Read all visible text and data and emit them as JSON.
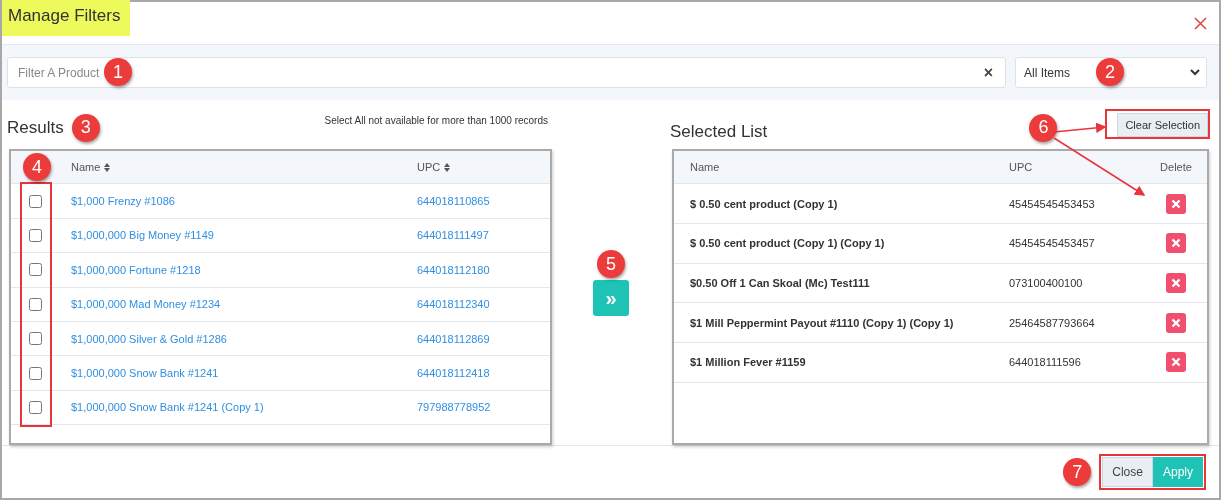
{
  "window": {
    "title": "Manage Filters",
    "title_highlighted": true
  },
  "filter": {
    "placeholder": "Filter A Product",
    "clear_icon": "×",
    "callout": "1"
  },
  "category_select": {
    "value": "All Items",
    "callout": "2"
  },
  "results": {
    "title": "Results",
    "callout": "3",
    "note": "Select All not available for more than 1000 records",
    "checkbox_callout": "4",
    "columns": [
      "Name",
      "UPC"
    ],
    "rows": [
      {
        "name": "$1,000 Frenzy #1086",
        "upc": "644018110865",
        "checked": false
      },
      {
        "name": "$1,000,000 Big Money #1149",
        "upc": "644018111497",
        "checked": false
      },
      {
        "name": "$1,000,000 Fortune #1218",
        "upc": "644018112180",
        "checked": false
      },
      {
        "name": "$1,000,000 Mad Money #1234",
        "upc": "644018112340",
        "checked": false
      },
      {
        "name": "$1,000,000 Silver & Gold #1286",
        "upc": "644018112869",
        "checked": false
      },
      {
        "name": "$1,000,000 Snow Bank #1241",
        "upc": "644018112418",
        "checked": false
      },
      {
        "name": "$1,000,000 Snow Bank #1241 (Copy 1)",
        "upc": "797988778952",
        "checked": false
      }
    ]
  },
  "move_button": {
    "label": "»",
    "callout": "5"
  },
  "selected": {
    "title": "Selected List",
    "clear_button": "Clear Selection",
    "callout": "6",
    "columns": [
      "Name",
      "UPC",
      "Delete"
    ],
    "rows": [
      {
        "name": "$ 0.50 cent product (Copy 1)",
        "upc": "45454545453453"
      },
      {
        "name": "$ 0.50 cent product (Copy 1) (Copy 1)",
        "upc": "45454545453457"
      },
      {
        "name": "$0.50 Off 1 Can Skoal (Mc) Test111",
        "upc": "073100400100"
      },
      {
        "name": "$1 Mill Peppermint Payout #1110 (Copy 1) (Copy 1)",
        "upc": "25464587793664"
      },
      {
        "name": "$1 Million Fever #1159",
        "upc": "644018111596"
      }
    ]
  },
  "footer": {
    "buttons": [
      "Close",
      "Apply"
    ],
    "callout": "7"
  }
}
